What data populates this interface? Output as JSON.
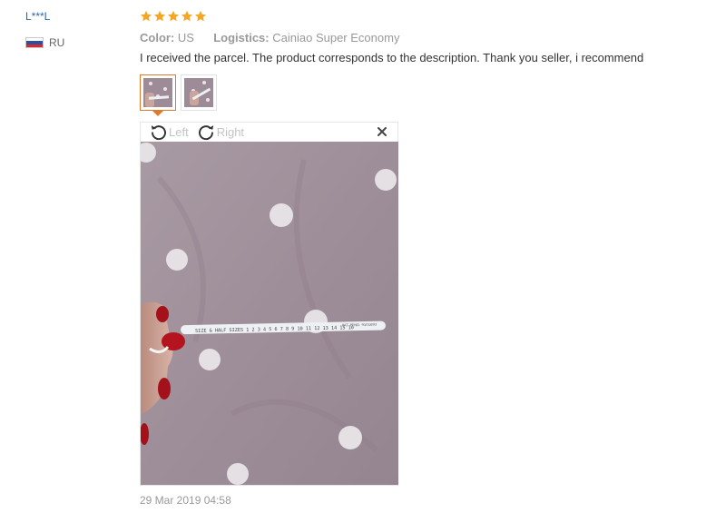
{
  "user": {
    "name": "L***L",
    "country_code": "RU",
    "flag_icon": "russia-flag-icon"
  },
  "review": {
    "rating": 5,
    "rating_max": 5,
    "star_color": "#f5a623",
    "color_label": "Color:",
    "color_value": "US",
    "logistics_label": "Logistics:",
    "logistics_value": "Cainiao Super Economy",
    "text": "I received the parcel. The product corresponds to the description. Thank you seller, i recommend",
    "date": "29 Mar 2019 04:58"
  },
  "thumbnails": [
    {
      "name": "photo-1",
      "active": true
    },
    {
      "name": "photo-2",
      "active": false
    }
  ],
  "viewer": {
    "rotate_left_label": "Left",
    "rotate_right_label": "Right",
    "close_icon": "close-icon",
    "photo_subject": "ring-sizer-on-polka-dot-fabric",
    "ruler_text": "SIZE & HALF SIZES 1 2 3 4 5 6 7 8 9 10 11 12 13 14 15 16",
    "ruler_tail": "PAT. PEND. 9101693"
  }
}
